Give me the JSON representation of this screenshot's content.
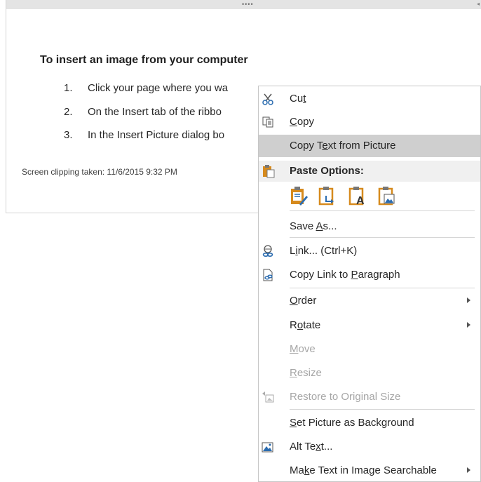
{
  "clipping": {
    "heading": "To insert an image from your computer",
    "steps": [
      {
        "num": "1.",
        "text": "Click your page where you wa"
      },
      {
        "num": "2.",
        "text": "On the Insert tab of the ribbo"
      },
      {
        "num": "3.",
        "text": "In the Insert Picture dialog bo"
      }
    ],
    "caption": "Screen clipping taken: 11/6/2015 9:32 PM",
    "grip": "••••",
    "edge_mark": "◂"
  },
  "menu": {
    "cut": {
      "pre": "Cu",
      "key": "t",
      "post": "",
      "icon": "scissors-icon"
    },
    "copy": {
      "pre": "",
      "key": "C",
      "post": "opy",
      "icon": "copy-icon"
    },
    "copy_text": {
      "pre": "Copy T",
      "key": "e",
      "post": "xt from Picture"
    },
    "paste_options": {
      "label": "Paste Options:",
      "icon": "paste-icon"
    },
    "paste_buttons": [
      "paste-keep-formatting-icon",
      "paste-merge-icon",
      "paste-text-only-icon",
      "paste-picture-icon"
    ],
    "save_as": {
      "pre": "Save ",
      "key": "A",
      "post": "s..."
    },
    "link": {
      "pre": "L",
      "key": "i",
      "post": "nk...  (Ctrl+K)",
      "icon": "link-icon"
    },
    "copy_link": {
      "pre": "Copy Link to ",
      "key": "P",
      "post": "aragraph",
      "icon": "page-link-icon"
    },
    "order": {
      "pre": "",
      "key": "O",
      "post": "rder"
    },
    "rotate": {
      "pre": "R",
      "key": "o",
      "post": "tate"
    },
    "move": {
      "pre": "",
      "key": "M",
      "post": "ove"
    },
    "resize": {
      "pre": "",
      "key": "R",
      "post": "esize"
    },
    "restore": {
      "label": "Restore to Original Size",
      "icon": "restore-size-icon"
    },
    "set_bg": {
      "pre": "",
      "key": "S",
      "post": "et Picture as Background"
    },
    "alt_text": {
      "pre": "Alt Te",
      "key": "x",
      "post": "t...",
      "icon": "alt-text-icon"
    },
    "searchable": {
      "pre": "Ma",
      "key": "k",
      "post": "e Text in Image Searchable"
    }
  },
  "colors": {
    "highlight": "#cfcfcf",
    "paste_header": "#f0f0f0",
    "disabled_text": "#a6a6a6",
    "icon_orange": "#d68a1d",
    "icon_blue": "#2b6cb0"
  }
}
